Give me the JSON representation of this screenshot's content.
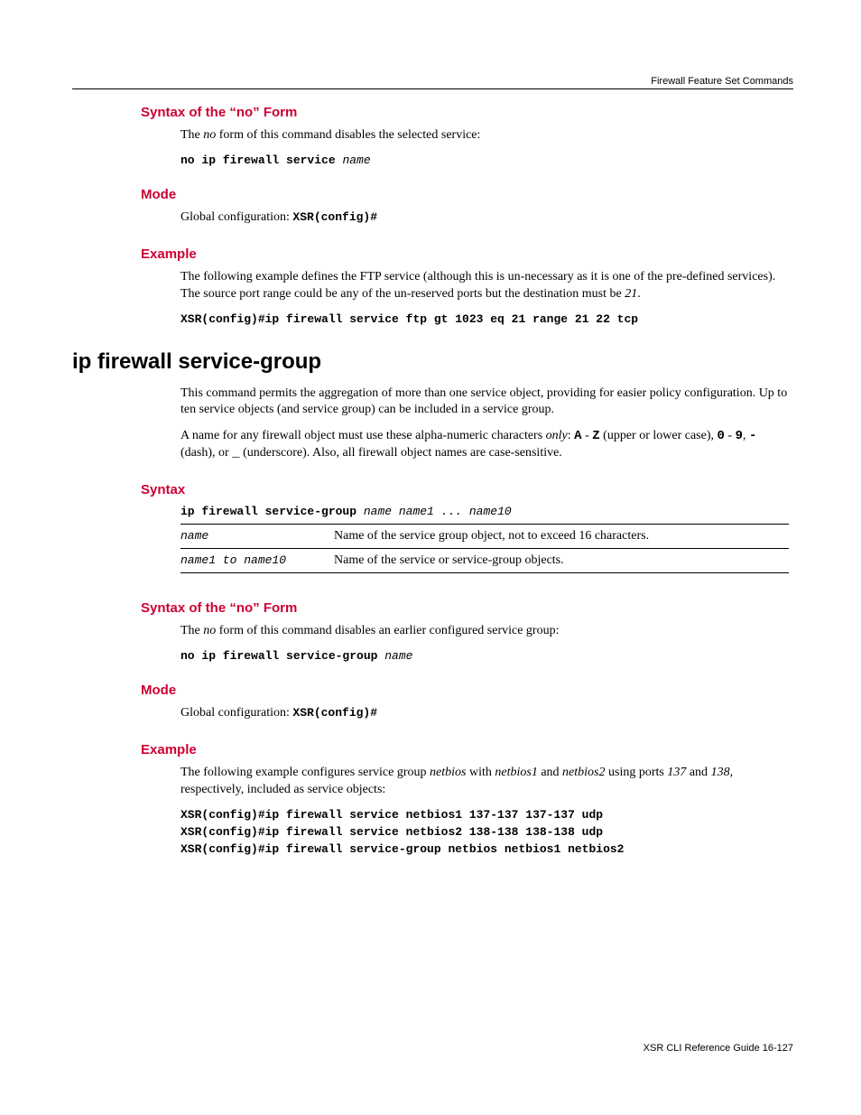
{
  "header": {
    "section_label": "Firewall Feature Set Commands"
  },
  "block1": {
    "syntax_no_heading": "Syntax of the “no” Form",
    "syntax_no_text_pre": "The ",
    "syntax_no_text_em": "no",
    "syntax_no_text_post": " form of this command disables the selected service:",
    "syntax_no_cmd_bold": "no ip firewall service ",
    "syntax_no_cmd_arg": "name",
    "mode_heading": "Mode",
    "mode_text_pre": "Global configuration: ",
    "mode_text_code": "XSR(config)#",
    "example_heading": "Example",
    "example_text_pre": "The following example defines the FTP service (although this is un-necessary as it is one of the pre-defined services). The source port range could be any of the un-reserved ports but the destination must be ",
    "example_text_em": "21",
    "example_text_post": ".",
    "example_cmd": "XSR(config)#ip firewall service ftp gt 1023 eq 21 range 21 22 tcp"
  },
  "block2": {
    "title": "ip firewall service-group",
    "intro1": "This command permits the aggregation of more than one service object, providing for easier policy configuration. Up to ten service objects (and service group) can be included in a service group.",
    "intro2_pre": "A name for any firewall object must use these alpha-numeric characters ",
    "intro2_only": "only",
    "intro2_mid1": ": ",
    "intro2_A": "A",
    "intro2_dash1": " - ",
    "intro2_Z": "Z",
    "intro2_mid2": " (upper or lower case), ",
    "intro2_0": "0",
    "intro2_dash2": " - ",
    "intro2_9": "9",
    "intro2_mid3": ", ",
    "intro2_hyphen": "-",
    "intro2_mid4": " (dash), or  ",
    "intro2_under": "_",
    "intro2_mid5": " (underscore). Also, all firewall object names are case-sensitive.",
    "syntax_heading": "Syntax",
    "syntax_cmd_bold": "ip firewall service-group ",
    "syntax_cmd_args": "name name1 ... name10",
    "table": [
      {
        "param": "name",
        "desc": "Name of the service group object, not to exceed 16 characters."
      },
      {
        "param": "name1 to name10",
        "desc": "Name of the service or service-group objects."
      }
    ],
    "syntax_no_heading": "Syntax of the “no” Form",
    "syntax_no_text_pre": "The ",
    "syntax_no_text_em": "no",
    "syntax_no_text_post": " form of this command disables an earlier configured service group:",
    "syntax_no_cmd_bold": "no ip firewall service-group ",
    "syntax_no_cmd_arg": "name",
    "mode_heading": "Mode",
    "mode_text_pre": "Global configuration: ",
    "mode_text_code": "XSR(config)#",
    "example_heading": "Example",
    "example_text_pre": "The following example configures service group ",
    "example_text_em1": "netbios",
    "example_text_mid1": " with ",
    "example_text_em2": "netbios1",
    "example_text_mid2": " and ",
    "example_text_em3": "netbios2",
    "example_text_mid3": " using ports ",
    "example_text_em4": "137",
    "example_text_mid4": " and ",
    "example_text_em5": "138",
    "example_text_post": ", respectively, included as service objects:",
    "example_cmds": [
      "XSR(config)#ip firewall service netbios1 137-137 137-137 udp",
      "XSR(config)#ip firewall service netbios2 138-138 138-138 udp",
      "XSR(config)#ip firewall service-group netbios netbios1 netbios2"
    ]
  },
  "footer": {
    "text": "XSR CLI Reference Guide   16-127"
  }
}
